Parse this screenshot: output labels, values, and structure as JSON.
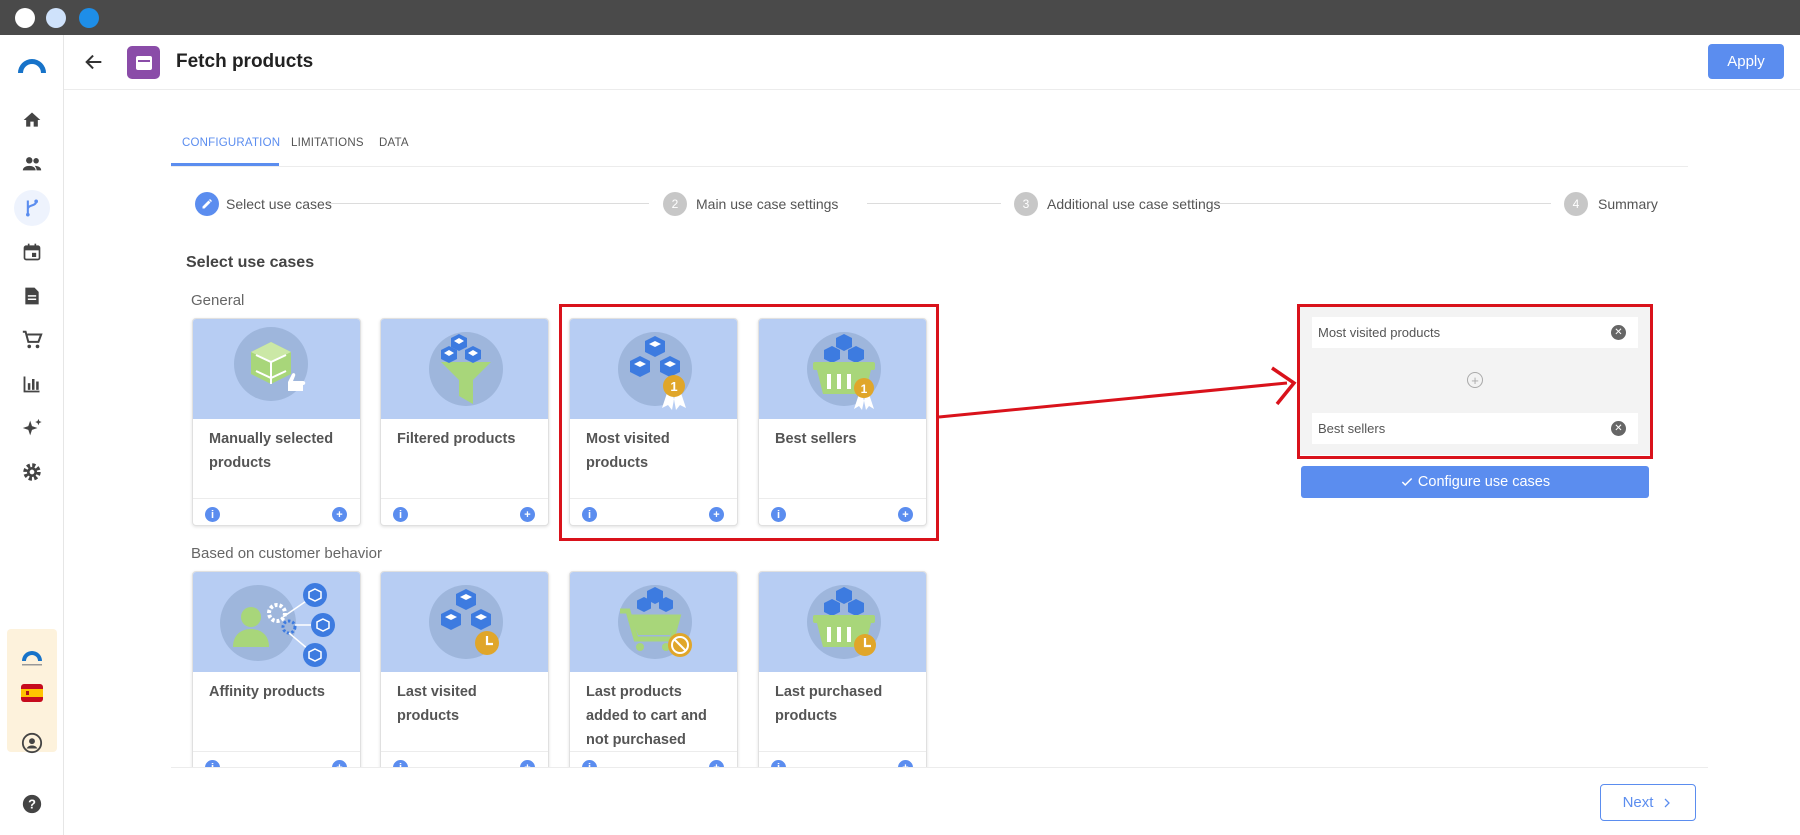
{
  "header": {
    "title": "Fetch products",
    "apply_label": "Apply"
  },
  "tabs": [
    {
      "label": "CONFIGURATION",
      "active": true
    },
    {
      "label": "LIMITATIONS",
      "active": false
    },
    {
      "label": "DATA",
      "active": false
    }
  ],
  "stepper": [
    {
      "number": "",
      "label": "Select use cases",
      "active": true
    },
    {
      "number": "2",
      "label": "Main use case settings",
      "active": false
    },
    {
      "number": "3",
      "label": "Additional use case settings",
      "active": false
    },
    {
      "number": "4",
      "label": "Summary",
      "active": false
    }
  ],
  "section_title": "Select use cases",
  "groups": [
    {
      "title": "General",
      "cards": [
        {
          "label": "Manually selected products",
          "icon": "cube-hand-icon"
        },
        {
          "label": "Filtered products",
          "icon": "funnel-cubes-icon"
        },
        {
          "label": "Most visited products",
          "icon": "cubes-medal-icon"
        },
        {
          "label": "Best sellers",
          "icon": "basket-medal-icon"
        }
      ]
    },
    {
      "title": "Based on customer behavior",
      "cards": [
        {
          "label": "Affinity products",
          "icon": "person-gears-icon"
        },
        {
          "label": "Last visited products",
          "icon": "cubes-clock-icon"
        },
        {
          "label": "Last products added to cart and not purchased",
          "icon": "cart-cancel-icon"
        },
        {
          "label": "Last purchased products",
          "icon": "basket-clock-icon"
        }
      ]
    }
  ],
  "selected": {
    "items": [
      "Most visited products",
      "Best sellers"
    ],
    "configure_label": "Configure use cases"
  },
  "footer": {
    "next_label": "Next"
  },
  "colors": {
    "accent": "#5b8def",
    "card_bg": "#b7cdf3",
    "highlight": "#d9121b",
    "badge": "#e0a62a",
    "cube_green": "#a8d67a"
  }
}
